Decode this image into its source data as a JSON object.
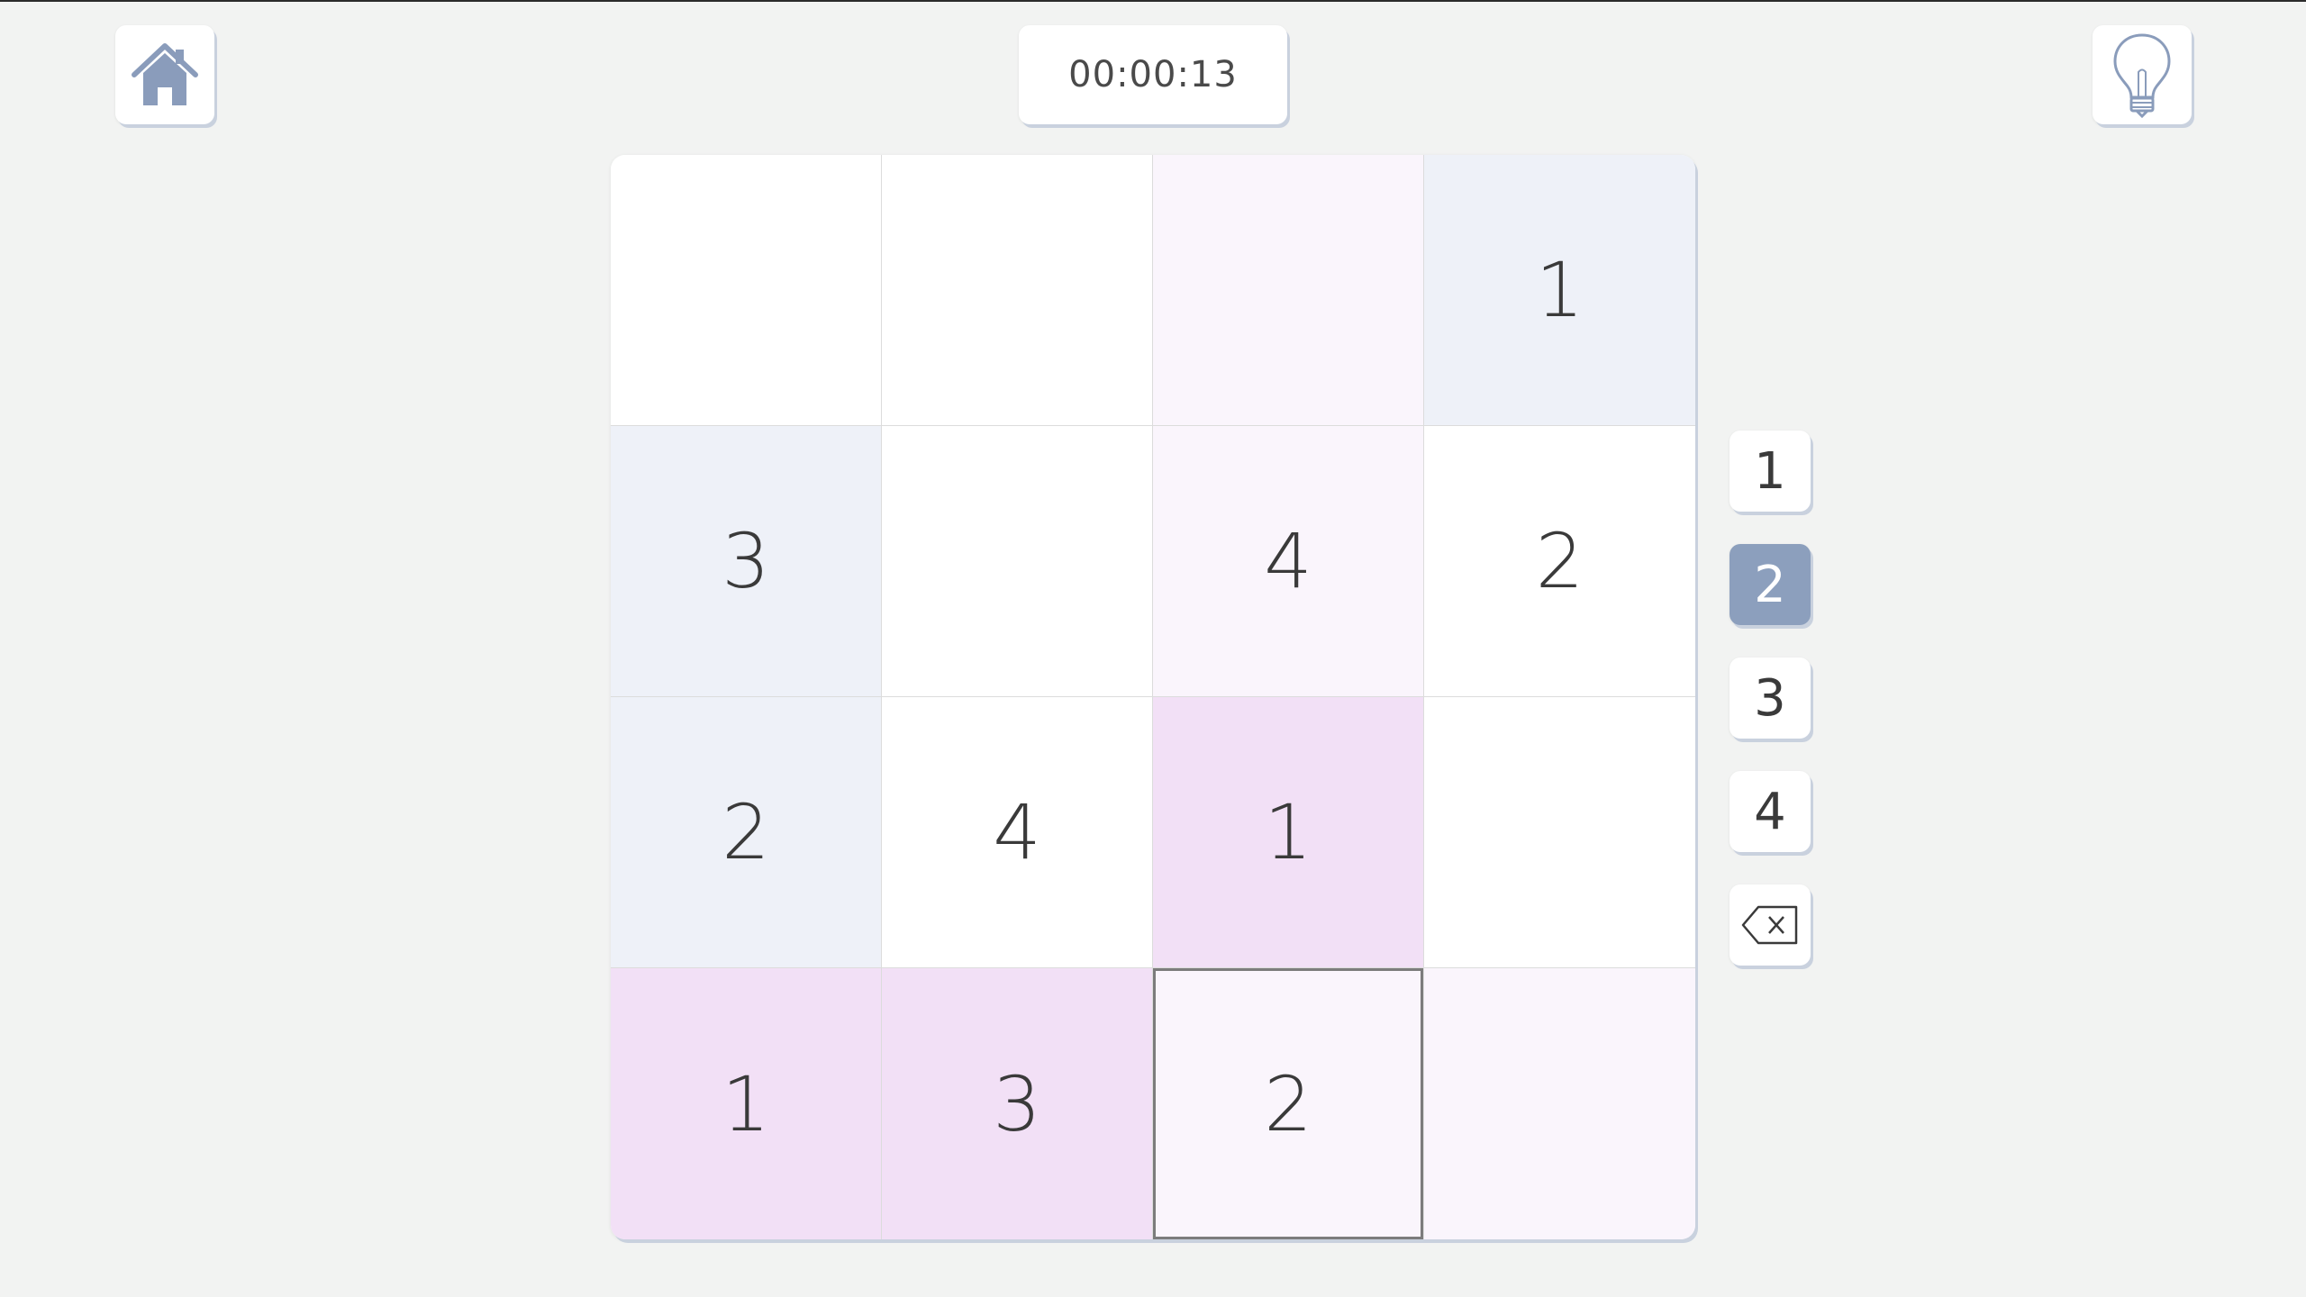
{
  "timer": "00:00:13",
  "icons": {
    "home": "home-icon",
    "hint": "lightbulb-icon",
    "erase": "backspace-icon"
  },
  "colors": {
    "accent": "#8c9fbd",
    "white": "#ffffff",
    "blue": "#eef1f8",
    "pink_light": "#faf5fc",
    "pink": "#f2e0f6",
    "icon": "#8a9cbb"
  },
  "grid": [
    [
      {
        "v": "",
        "bg": "white"
      },
      {
        "v": "",
        "bg": "white"
      },
      {
        "v": "",
        "bg": "pink_light"
      },
      {
        "v": "1",
        "bg": "blue"
      }
    ],
    [
      {
        "v": "3",
        "bg": "blue"
      },
      {
        "v": "",
        "bg": "white"
      },
      {
        "v": "4",
        "bg": "pink_light"
      },
      {
        "v": "2",
        "bg": "white"
      }
    ],
    [
      {
        "v": "2",
        "bg": "blue"
      },
      {
        "v": "4",
        "bg": "white"
      },
      {
        "v": "1",
        "bg": "pink"
      },
      {
        "v": "",
        "bg": "white"
      }
    ],
    [
      {
        "v": "1",
        "bg": "pink"
      },
      {
        "v": "3",
        "bg": "pink"
      },
      {
        "v": "2",
        "bg": "pink_light",
        "selected": true
      },
      {
        "v": "",
        "bg": "pink_light"
      }
    ]
  ],
  "numpad": {
    "buttons": [
      "1",
      "2",
      "3",
      "4"
    ],
    "active": "2"
  }
}
